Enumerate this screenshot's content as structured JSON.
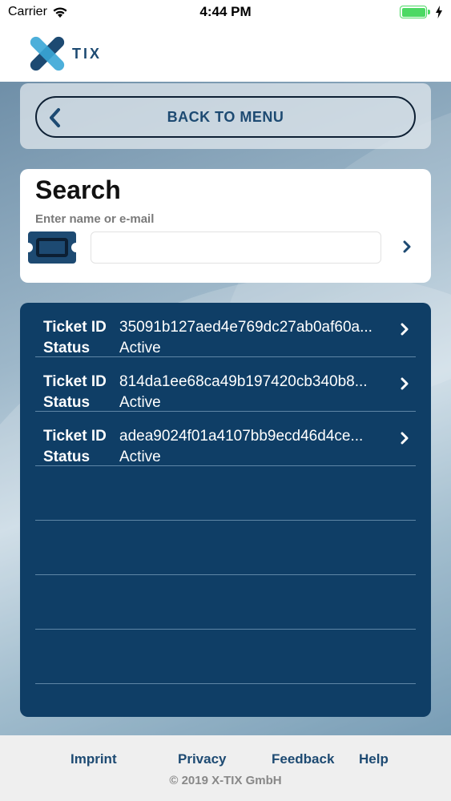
{
  "status_bar": {
    "carrier": "Carrier",
    "time": "4:44 PM"
  },
  "brand": {
    "name": "TIX",
    "color": "#1d4a72"
  },
  "back": {
    "label": "BACK TO MENU"
  },
  "search": {
    "title": "Search",
    "subtitle": "Enter name or e-mail",
    "value": "",
    "placeholder": ""
  },
  "tickets": {
    "id_label": "Ticket ID",
    "status_label": "Status",
    "items": [
      {
        "id": "35091b127aed4e769dc27ab0af60a...",
        "status": "Active"
      },
      {
        "id": "814da1ee68ca49b197420cb340b8...",
        "status": "Active"
      },
      {
        "id": "adea9024f01a4107bb9ecd46d4ce...",
        "status": "Active"
      }
    ]
  },
  "footer": {
    "imprint": "Imprint",
    "privacy": "Privacy",
    "feedback": "Feedback",
    "help": "Help",
    "copyright": "© 2019 X-TIX GmbH"
  },
  "colors": {
    "accent": "#1d4a72",
    "list_bg": "#0f3e66",
    "battery": "#4cd964"
  }
}
